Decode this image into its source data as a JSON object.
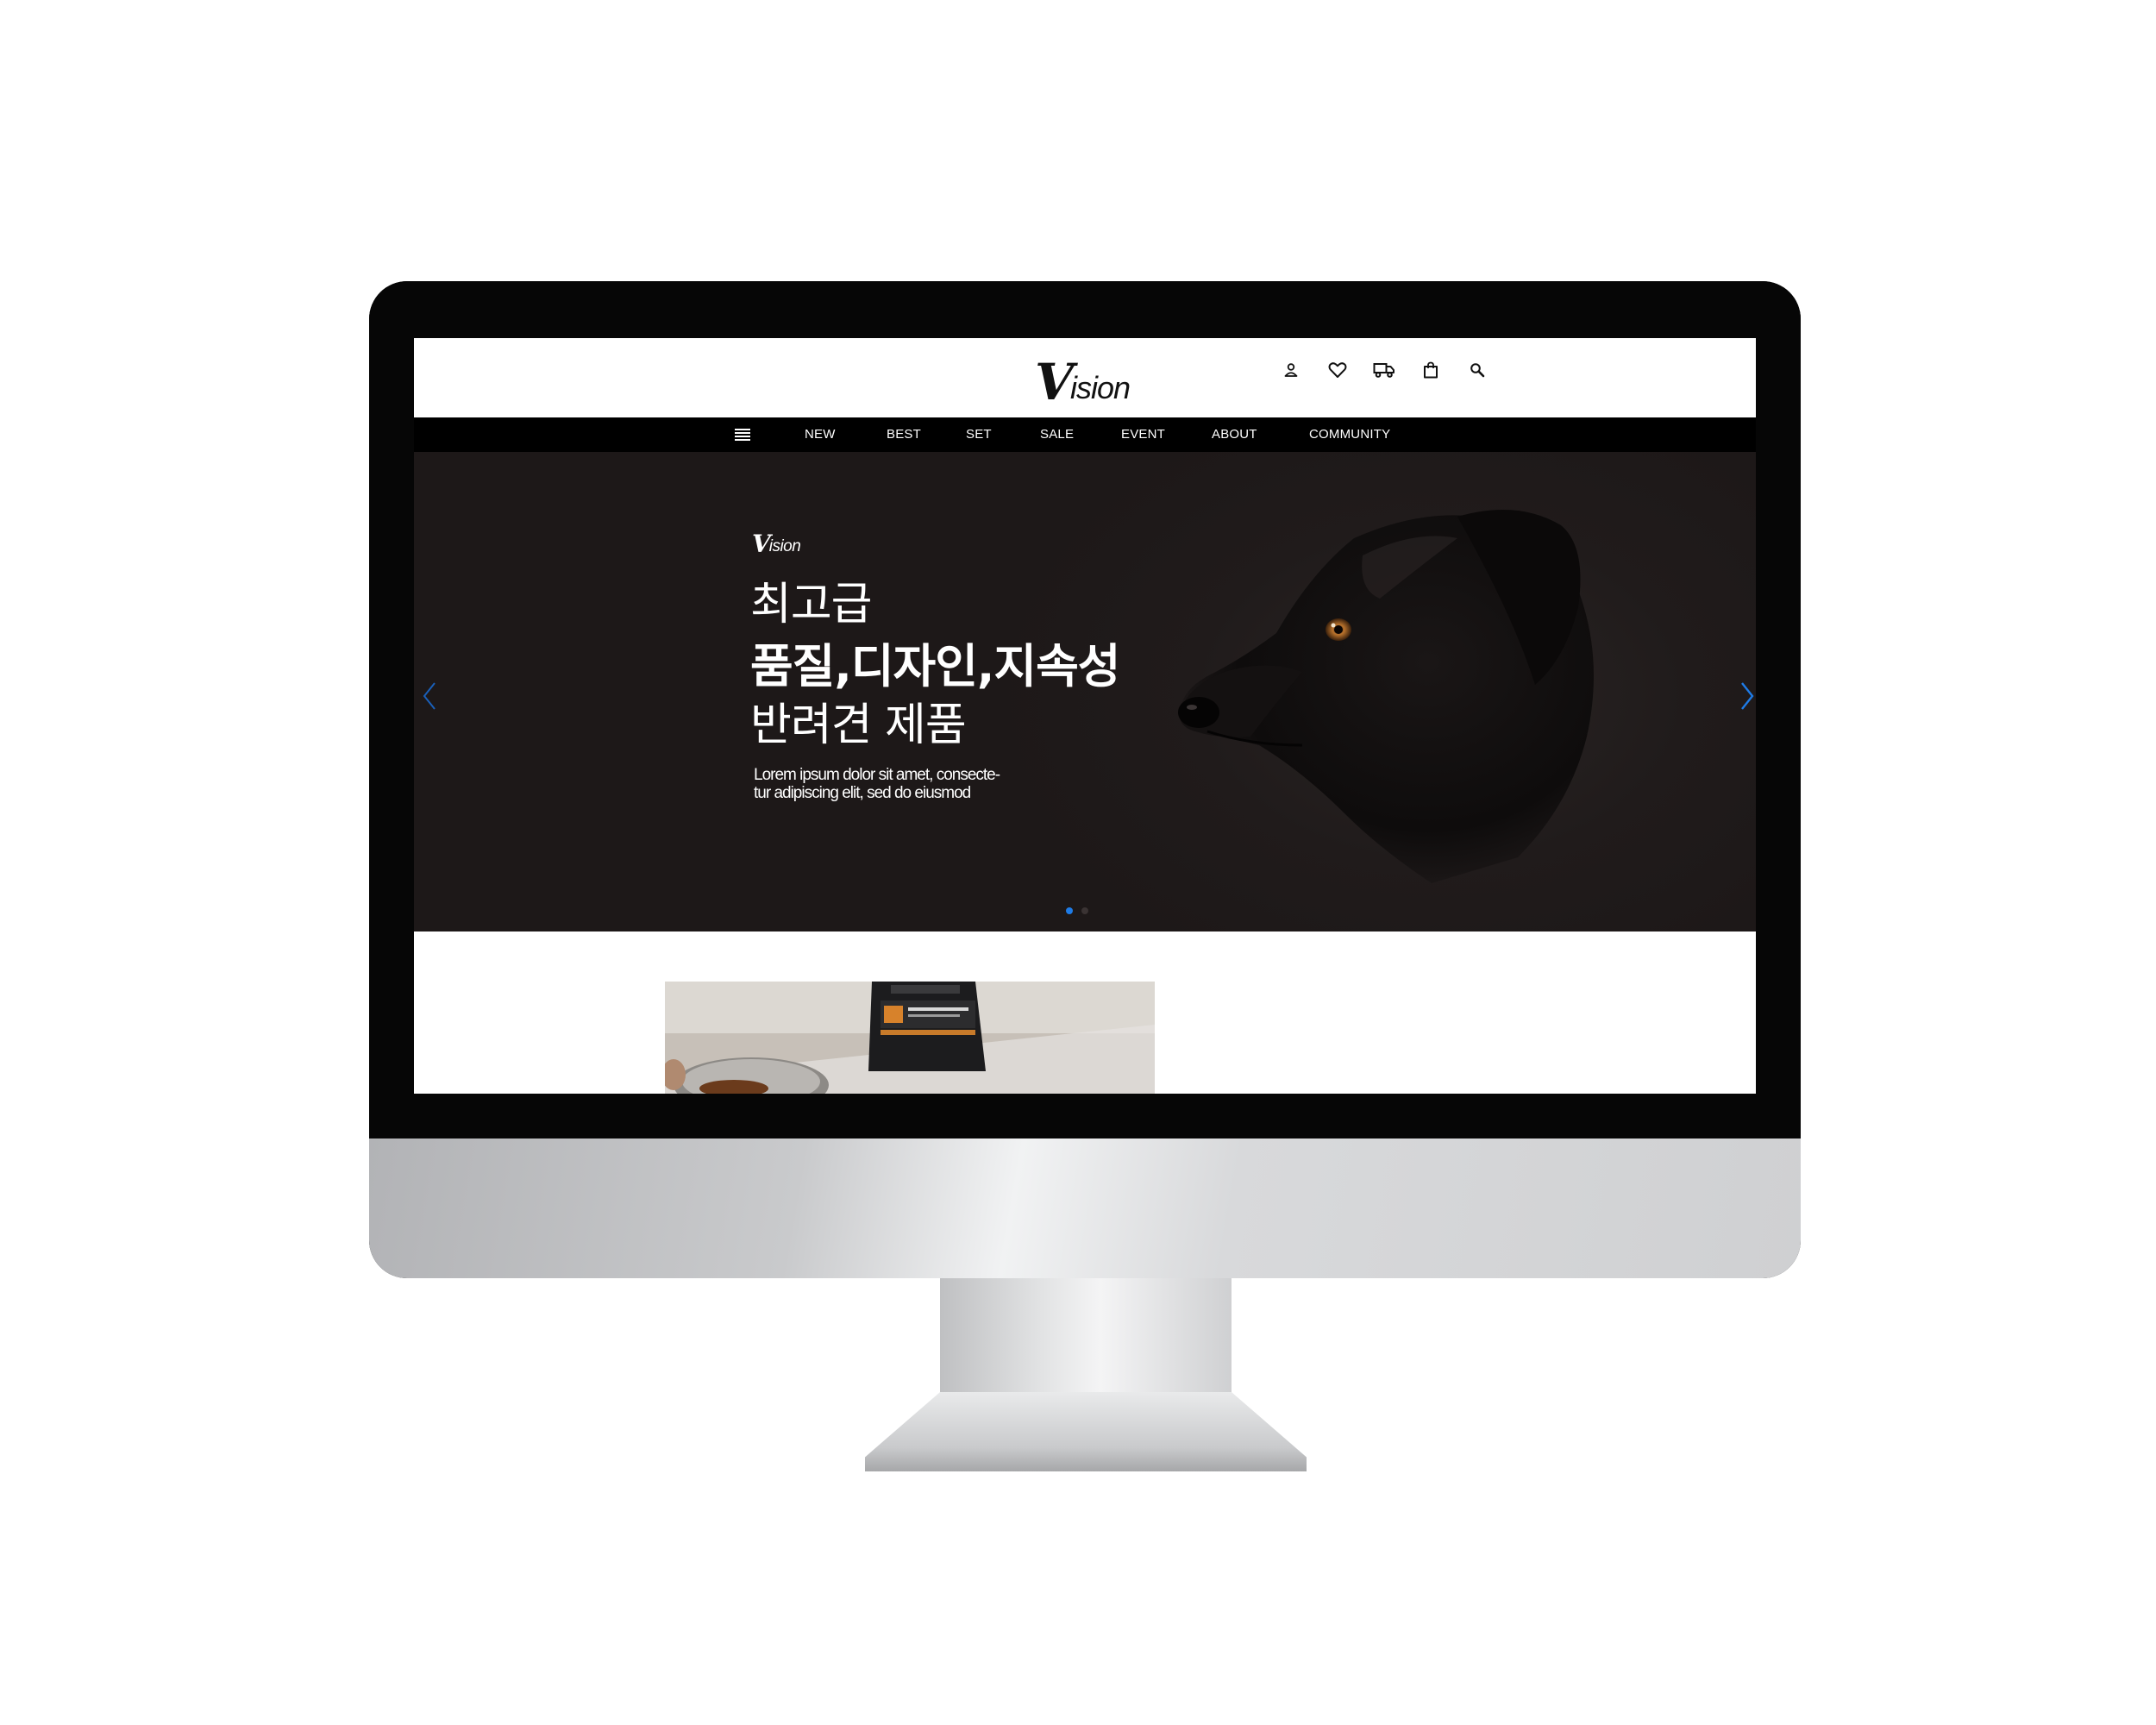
{
  "site": {
    "logo_mark": "V",
    "logo_rest": "ision"
  },
  "header": {
    "icons": [
      "user-icon",
      "heart-icon",
      "truck-icon",
      "shopping-bag-icon",
      "search-icon"
    ]
  },
  "nav": {
    "menu_icon": "hamburger-menu-icon",
    "items": [
      {
        "label": "NEW"
      },
      {
        "label": "BEST"
      },
      {
        "label": "SET"
      },
      {
        "label": "SALE"
      },
      {
        "label": "EVENT"
      },
      {
        "label": "ABOUT"
      },
      {
        "label": "COMMUNITY"
      }
    ]
  },
  "hero": {
    "logo_mark": "V",
    "logo_rest": "ision",
    "line1": "최고급",
    "line2": "품질,디자인,지속성",
    "line3": "반려견 제품",
    "description_line1": "Lorem ipsum dolor sit amet, consecte-",
    "description_line2": "tur adipiscing elit, sed do eiusmod",
    "active_slide": 1,
    "slide_count": 2,
    "arrow_color": "#1e7be6"
  },
  "colors": {
    "nav_bg": "#000000",
    "hero_bg": "#201b1b",
    "accent": "#1e7be6"
  }
}
